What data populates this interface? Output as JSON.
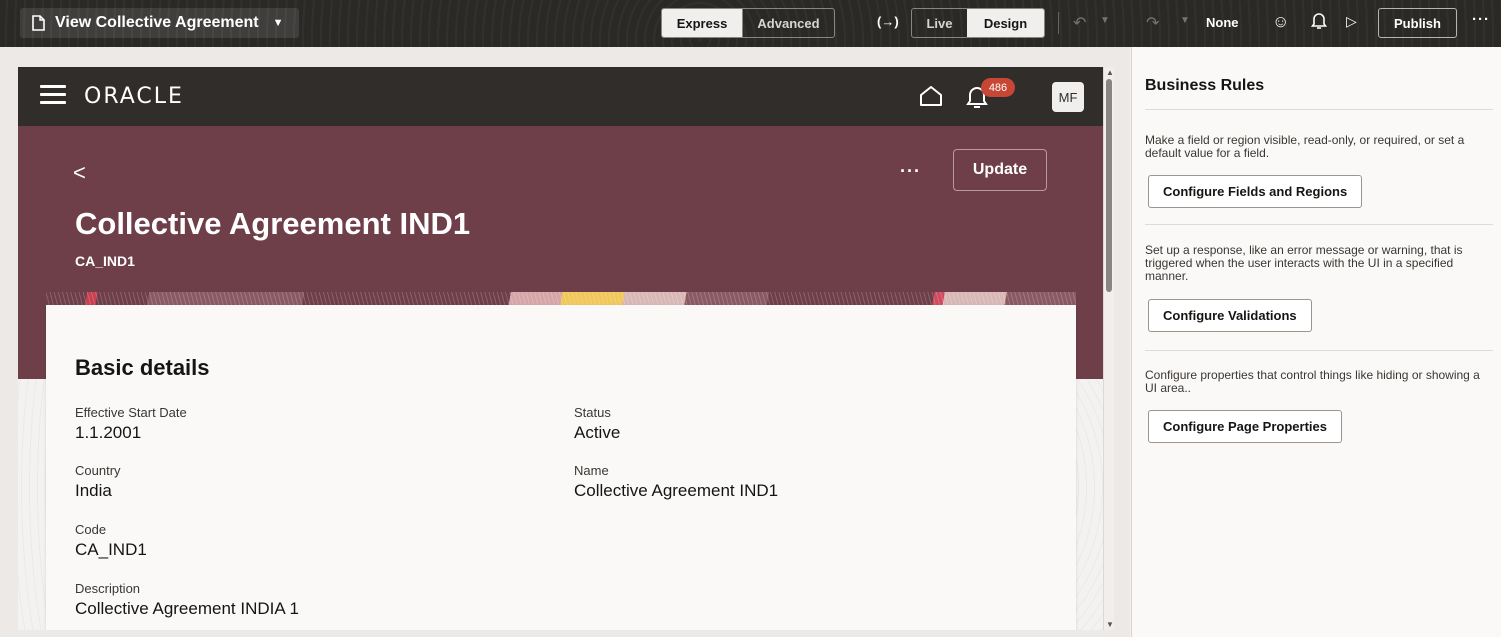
{
  "toolbar": {
    "page_name": "View Collective Agreement",
    "mode_express": "Express",
    "mode_advanced": "Advanced",
    "arrow_glyph": "(→)",
    "view_live": "Live",
    "view_design": "Design",
    "undo_glyph": "↶",
    "redo_glyph": "↷",
    "none_label": "None",
    "publish_label": "Publish",
    "more_glyph": "···"
  },
  "app_header": {
    "logo_text": "ORACLE",
    "notification_count": "486",
    "avatar_initials": "MF"
  },
  "hero": {
    "back_glyph": "<",
    "more_glyph": "···",
    "update_label": "Update",
    "title": "Collective Agreement IND1",
    "subtitle": "CA_IND1"
  },
  "details": {
    "section_title": "Basic details",
    "fields": [
      {
        "label": "Effective Start Date",
        "value": "1.1.2001"
      },
      {
        "label": "Status",
        "value": "Active"
      },
      {
        "label": "Country",
        "value": "India"
      },
      {
        "label": "Name",
        "value": "Collective Agreement IND1"
      },
      {
        "label": "Code",
        "value": "CA_IND1"
      },
      {
        "label": "Description",
        "value": "Collective Agreement INDIA 1"
      }
    ]
  },
  "business_rules": {
    "title": "Business Rules",
    "items": [
      {
        "description": "Make a field or region visible, read-only, or required, or set a default value for a field.",
        "button": "Configure Fields and Regions"
      },
      {
        "description": "Set up a response, like an error message or warning, that is triggered when the user interacts with the UI in a specified manner.",
        "button": "Configure Validations"
      },
      {
        "description": "Configure properties that control things like hiding or showing a UI area..",
        "button": "Configure Page Properties"
      }
    ]
  },
  "colors": {
    "toolbar_bg": "#2b2926",
    "oracle_header_bg": "#312d2a",
    "hero_bg": "#6e3f49",
    "badge_red": "#c74634"
  }
}
